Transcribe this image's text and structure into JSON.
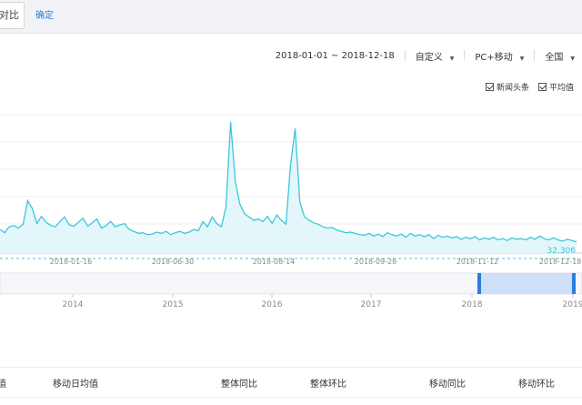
{
  "topbar": {
    "compare_label": "对比",
    "confirm_label": "确定"
  },
  "filters": {
    "date_range": "2018-01-01 ~ 2018-12-18",
    "custom_label": "自定义",
    "platform_label": "PC+移动",
    "region_label": "全国"
  },
  "legend": {
    "items": [
      "新闻头条",
      "平均值"
    ]
  },
  "chart_data": {
    "type": "area",
    "x_ticks": [
      "2018-01-16",
      "2018-06-30",
      "2018-08-14",
      "2018-09-28",
      "2018-11-12",
      "2018-12-18"
    ],
    "average": {
      "label": "32,306",
      "value": 32306
    },
    "series": [
      {
        "values": [
          36,
          31,
          40,
          42,
          38,
          44,
          80,
          68,
          45,
          56,
          47,
          42,
          40,
          48,
          55,
          43,
          41,
          47,
          53,
          41,
          46,
          52,
          38,
          42,
          48,
          40,
          43,
          45,
          36,
          33,
          30,
          31,
          28,
          29,
          32,
          30,
          33,
          28,
          31,
          33,
          30,
          32,
          36,
          34,
          48,
          40,
          55,
          45,
          40,
          70,
          200,
          110,
          75,
          60,
          55,
          50,
          52,
          48,
          56,
          45,
          58,
          50,
          44,
          135,
          190,
          78,
          55,
          50,
          46,
          44,
          40,
          38,
          39,
          35,
          33,
          31,
          32,
          30,
          28,
          27,
          30,
          26,
          29,
          25,
          31,
          28,
          26,
          29,
          24,
          30,
          26,
          28,
          25,
          28,
          22,
          27,
          24,
          26,
          23,
          25,
          21,
          24,
          22,
          25,
          20,
          23,
          21,
          24,
          20,
          22,
          19,
          23,
          21,
          22,
          20,
          24,
          21,
          26,
          22,
          20,
          23,
          20,
          18,
          21,
          19,
          17
        ]
      }
    ],
    "overview_axis": [
      "2014",
      "2015",
      "2016",
      "2017",
      "2018",
      "2019"
    ]
  },
  "table_header": {
    "columns": [
      "值",
      "移动日均值",
      "整体同比",
      "整体环比",
      "移动同比",
      "移动环比"
    ]
  },
  "colors": {
    "line": "#3cc7db",
    "area": "#e3f6fa",
    "accent": "#2a7de1",
    "selection": "#c4d8f7"
  }
}
